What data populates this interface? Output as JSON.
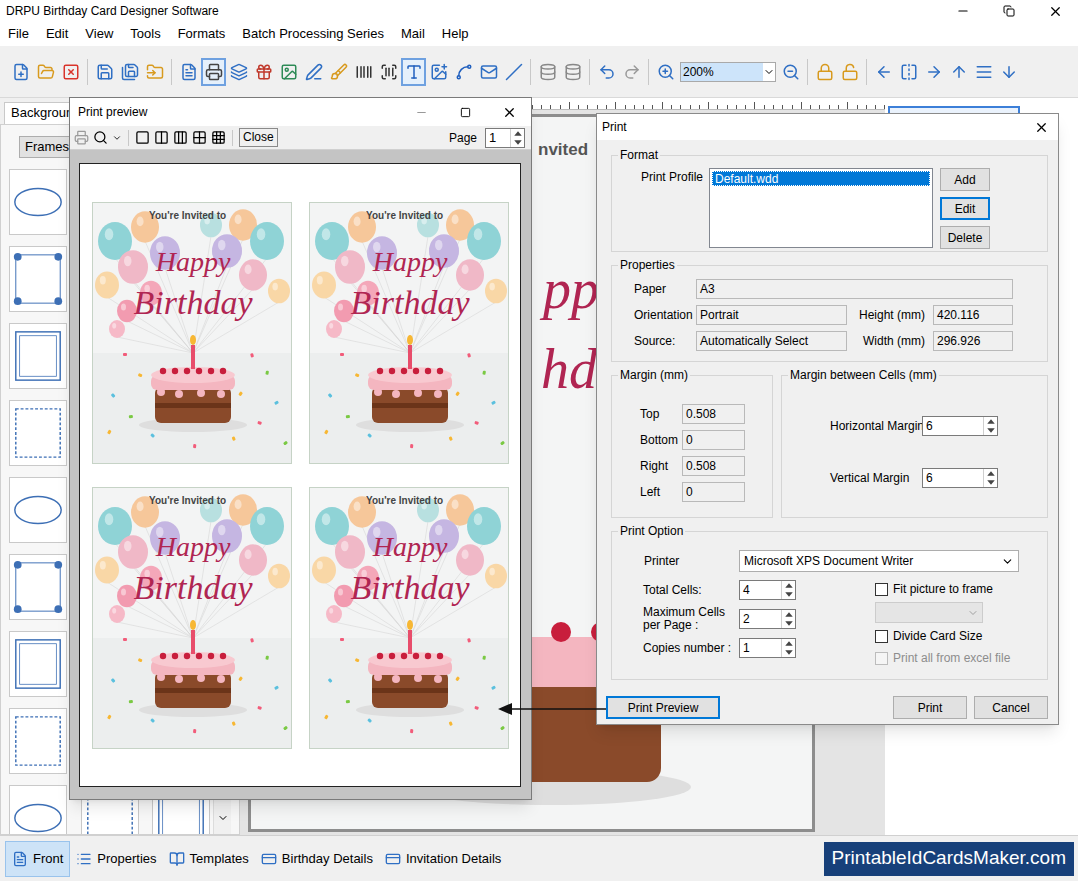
{
  "window": {
    "title": "DRPU Birthday Card Designer Software"
  },
  "menu": [
    "File",
    "Edit",
    "View",
    "Tools",
    "Formats",
    "Batch Processing Series",
    "Mail",
    "Help"
  ],
  "toolbar": {
    "buttons": [
      {
        "selected": false
      },
      {
        "selected": false
      },
      {
        "selected": false
      },
      {
        "selected": false
      },
      {
        "selected": false
      },
      {
        "selected": false
      },
      {
        "selected": false
      },
      {
        "selected": true
      },
      {
        "selected": false
      },
      {
        "selected": false
      },
      {
        "selected": false
      },
      {
        "selected": false
      },
      {
        "selected": false
      },
      {
        "selected": false
      },
      {
        "selected": false
      },
      {
        "selected": true
      },
      {
        "selected": false
      },
      {
        "selected": false
      },
      {
        "selected": false
      },
      {
        "selected": false
      },
      {
        "selected": false
      },
      {
        "selected": false
      },
      {
        "selected": false
      },
      {
        "selected": false
      },
      {
        "selected": false
      },
      {
        "selected": false
      },
      {
        "selected": false
      },
      {
        "selected": false
      },
      {
        "selected": false
      },
      {
        "selected": false
      },
      {
        "selected": false
      },
      {
        "selected": false
      },
      {
        "selected": false
      },
      {
        "selected": false
      }
    ],
    "zoom": "200%"
  },
  "left_panel": {
    "tab": {
      "label": "Backgroun",
      "selected": true
    },
    "button": "Frames"
  },
  "canvas": {
    "visible_text": [
      {
        "text": "nvited",
        "kind": "invite"
      },
      {
        "text": "pp",
        "kind": "title"
      },
      {
        "text": "hd",
        "kind": "title"
      }
    ]
  },
  "bottom_tabs": [
    {
      "label": "Front",
      "selected": true
    },
    {
      "label": "Properties",
      "selected": false
    },
    {
      "label": "Templates",
      "selected": false
    },
    {
      "label": "Birthday Details",
      "selected": false
    },
    {
      "label": "Invitation Details",
      "selected": false
    }
  ],
  "watermark": "PrintableIdCardsMaker.com",
  "print_preview": {
    "title": "Print preview",
    "close": "Close",
    "page_label": "Page",
    "page": "1",
    "cards": [
      {
        "invite": "You're Invited to",
        "line1": "Happy",
        "line2": "Birthday"
      },
      {
        "invite": "You're Invited to",
        "line1": "Happy",
        "line2": "Birthday"
      },
      {
        "invite": "You're Invited to",
        "line1": "Happy",
        "line2": "Birthday"
      },
      {
        "invite": "You're Invited to",
        "line1": "Happy",
        "line2": "Birthday"
      }
    ]
  },
  "print_dialog": {
    "title": "Print",
    "format": {
      "legend": "Format",
      "profile_label": "Print Profile",
      "profiles": [
        {
          "label": "Default.wdd",
          "selected": true
        }
      ],
      "buttons": [
        {
          "label": "Add",
          "focused": false
        },
        {
          "label": "Edit",
          "focused": true
        },
        {
          "label": "Delete",
          "focused": false
        }
      ]
    },
    "properties": {
      "legend": "Properties",
      "paper_label": "Paper",
      "paper": "A3",
      "orientation_label": "Orientation",
      "orientation": "Portrait",
      "source_label": "Source:",
      "source": "Automatically Select",
      "height_label": "Height (mm)",
      "height": "420.116",
      "width_label": "Width (mm)",
      "width": "296.926"
    },
    "margin": {
      "legend": "Margin (mm)",
      "fields": [
        {
          "label": "Top",
          "value": "0.508"
        },
        {
          "label": "Bottom",
          "value": "0"
        },
        {
          "label": "Right",
          "value": "0.508"
        },
        {
          "label": "Left",
          "value": "0"
        }
      ]
    },
    "cell_margin": {
      "legend": "Margin between Cells (mm)",
      "fields": [
        {
          "label": "Horizontal Margin",
          "value": "6"
        },
        {
          "label": "Vertical Margin",
          "value": "6"
        }
      ]
    },
    "print_option": {
      "legend": "Print Option",
      "printer_label": "Printer",
      "printer": "Microsoft XPS Document Writer",
      "spinners": [
        {
          "label": "Total Cells:",
          "value": "4"
        },
        {
          "label": "Maximum Cells per Page :",
          "value": "2"
        },
        {
          "label": "Copies number :",
          "value": "1"
        }
      ],
      "checks": [
        {
          "label": "Fit picture to frame",
          "checked": false,
          "disabled": false
        },
        {
          "label": "Divide Card Size",
          "checked": false,
          "disabled": false
        },
        {
          "label": "Print all from excel file",
          "checked": false,
          "disabled": true
        }
      ],
      "fit_combo_disabled": true
    },
    "buttons": [
      {
        "label": "Print Preview",
        "focused": true
      },
      {
        "label": "Print",
        "focused": false
      },
      {
        "label": "Cancel",
        "focused": false
      }
    ]
  }
}
